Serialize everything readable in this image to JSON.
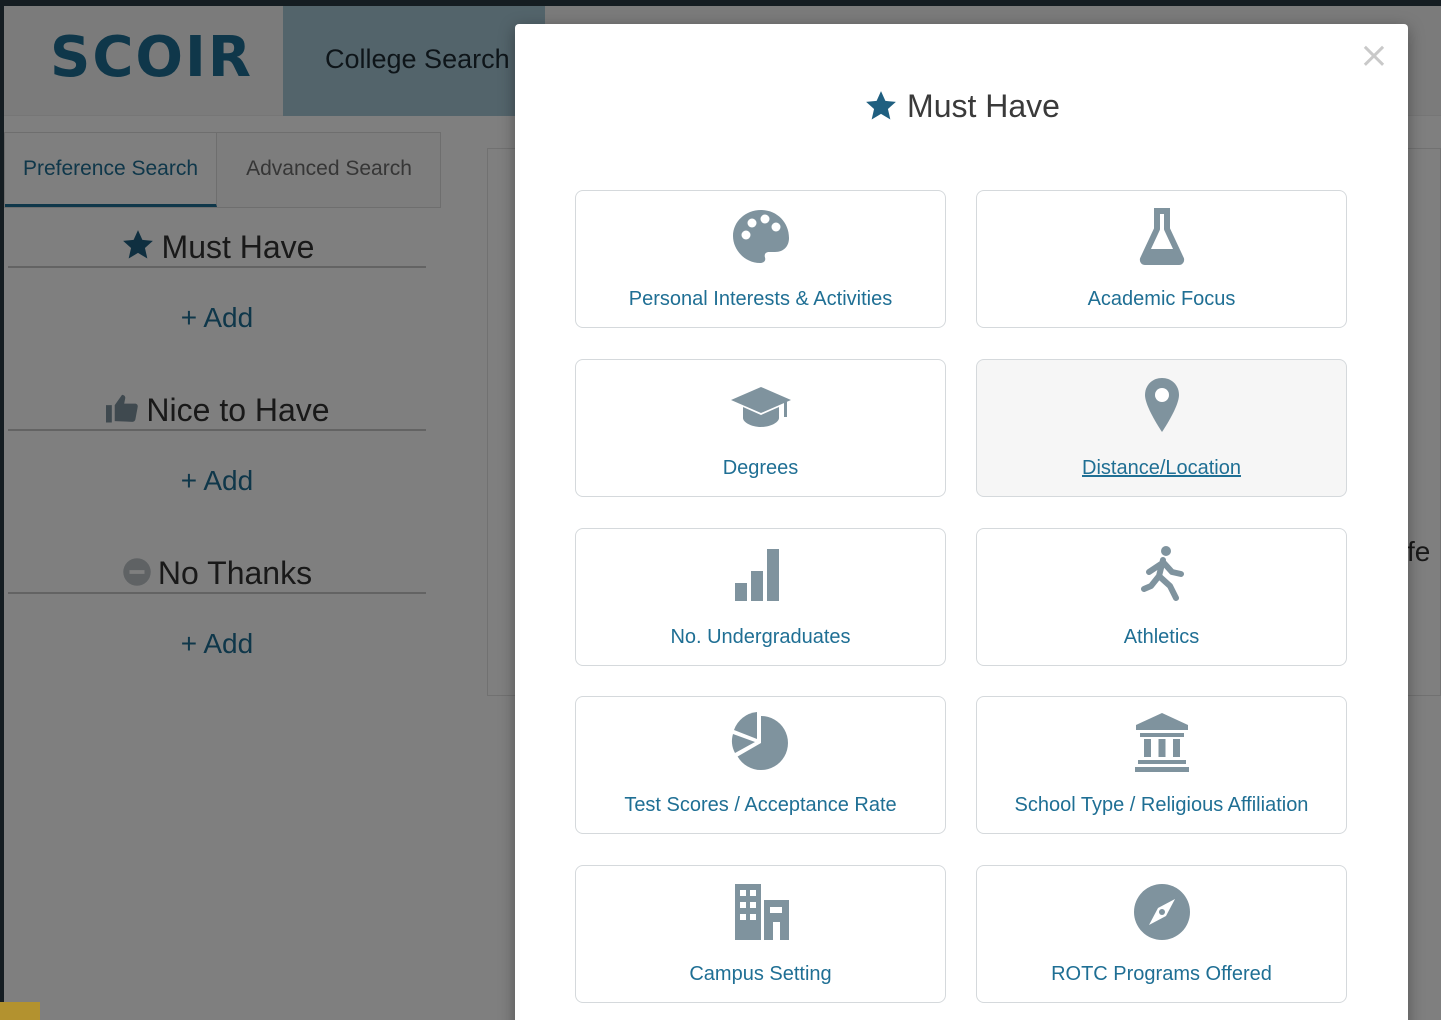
{
  "app": {
    "logo_text": "SCOIR",
    "nav_item": "College Search",
    "tabs": [
      "Preference Search",
      "Advanced Search"
    ],
    "preferences": [
      {
        "title": "Must Have",
        "icon": "star-icon",
        "add_label": "+ Add"
      },
      {
        "title": "Nice to Have",
        "icon": "thumbs-up-icon",
        "add_label": "+ Add"
      },
      {
        "title": "No Thanks",
        "icon": "minus-circle-icon",
        "add_label": "+ Add"
      }
    ],
    "right_fragment": "fe"
  },
  "modal": {
    "title": "Must Have",
    "title_icon": "star-icon",
    "close_icon": "close-icon",
    "options": [
      {
        "label": "Personal Interests & Activities",
        "icon": "palette-icon"
      },
      {
        "label": "Academic Focus",
        "icon": "flask-icon"
      },
      {
        "label": "Degrees",
        "icon": "graduation-cap-icon"
      },
      {
        "label": "Distance/Location",
        "icon": "map-pin-icon",
        "hovered": true
      },
      {
        "label": "No. Undergraduates",
        "icon": "bar-chart-icon"
      },
      {
        "label": "Athletics",
        "icon": "runner-icon"
      },
      {
        "label": "Test Scores / Acceptance Rate",
        "icon": "pie-chart-icon"
      },
      {
        "label": "School Type / Religious Affiliation",
        "icon": "institution-icon"
      },
      {
        "label": "Campus Setting",
        "icon": "buildings-icon"
      },
      {
        "label": "ROTC Programs Offered",
        "icon": "compass-icon"
      }
    ]
  },
  "colors": {
    "accent": "#1f6f94",
    "icon_gray": "#7f939e",
    "star": "#1f5f80"
  }
}
